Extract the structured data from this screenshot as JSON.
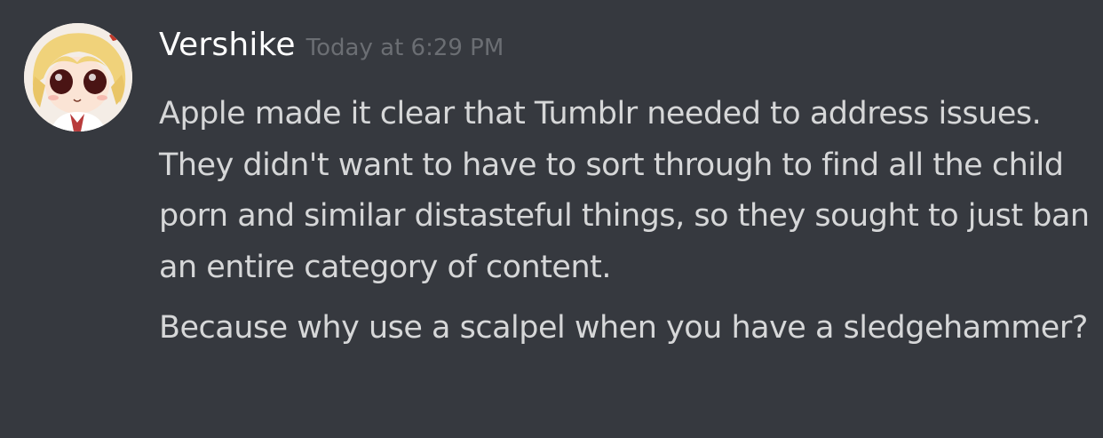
{
  "message": {
    "author": "Vershike",
    "timestamp": "Today at 6:29 PM",
    "avatar_icon": "anime-character-avatar-icon",
    "paragraphs": [
      "Apple made it clear that Tumblr needed to address issues. They didn't want to have to sort through to find all the child porn and similar distasteful things, so they sought to just ban an entire category of content.",
      "Because why use a scalpel when you have a sledgehammer?"
    ]
  },
  "colors": {
    "background": "#36393f",
    "username": "#ffffff",
    "timestamp": "#6b6e73",
    "body_text": "#d6d7d8"
  }
}
